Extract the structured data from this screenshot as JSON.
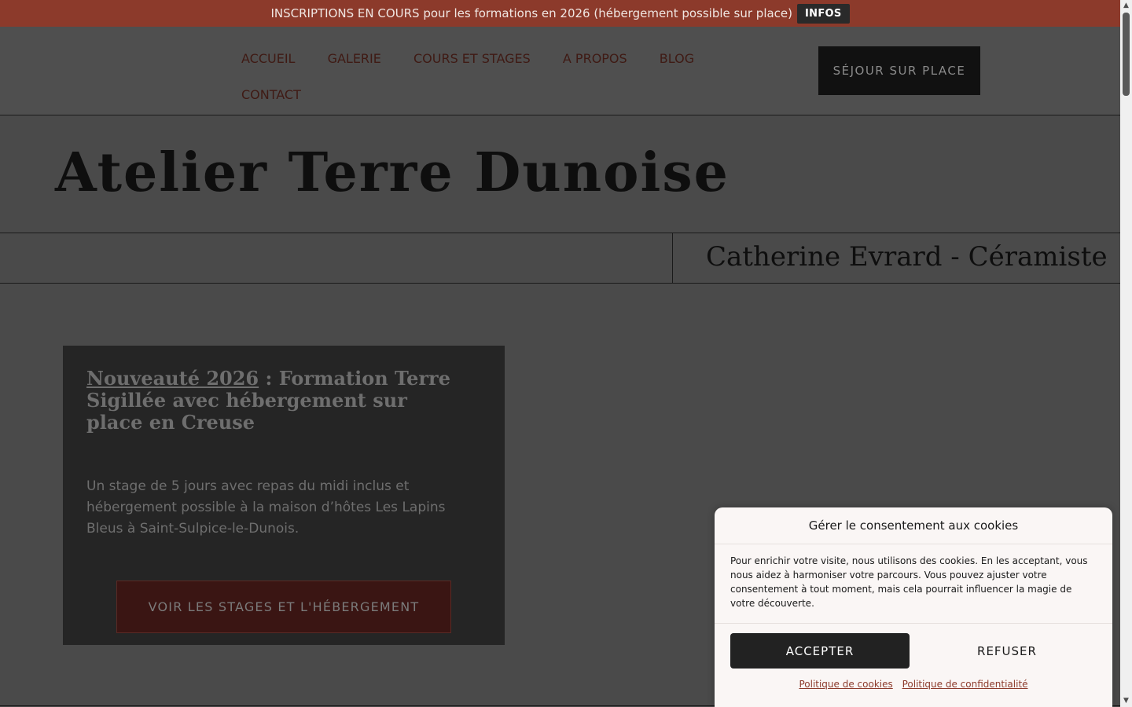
{
  "topbar": {
    "message": "INSCRIPTIONS EN COURS pour les formations en 2026 (hébergement possible sur place)",
    "infos_label": "INFOS"
  },
  "nav": {
    "items": [
      "ACCUEIL",
      "GALERIE",
      "COURS ET STAGES",
      "A PROPOS",
      "BLOG",
      "CONTACT"
    ],
    "cta_label": "SÉJOUR SUR PLACE"
  },
  "hero": {
    "title": "Atelier Terre Dunoise",
    "subtitle": "Catherine Evrard - Céramiste"
  },
  "card": {
    "title_link": "Nouveauté 2026",
    "title_rest": " : Formation Terre Sigillée avec hébergement sur place en Creuse",
    "body": "Un stage de 5 jours avec repas du midi inclus et hébergement possible à la maison d’hôtes Les Lapins Bleus à Saint-Sulpice-le-Dunois.",
    "button": "VOIR LES STAGES ET L'HÉBERGEMENT"
  },
  "cookie": {
    "title": "Gérer le consentement aux cookies",
    "text": "Pour enrichir votre visite, nous utilisons des cookies. En les acceptant, vous nous aidez à harmoniser votre parcours. Vous pouvez ajuster votre consentement à tout moment, mais cela pourrait influencer la magie de votre découverte.",
    "accept": "ACCEPTER",
    "refuse": "REFUSER",
    "link_cookies": "Politique de cookies",
    "link_privacy": "Politique de confidentialité"
  },
  "colors": {
    "topbar": "#8c3a2b",
    "background": "#4a4a4a",
    "card": "#252525",
    "cta_dark": "#111111"
  },
  "icons": {
    "scroll_up": "triangle-up-icon",
    "scroll_down": "triangle-down-icon"
  }
}
